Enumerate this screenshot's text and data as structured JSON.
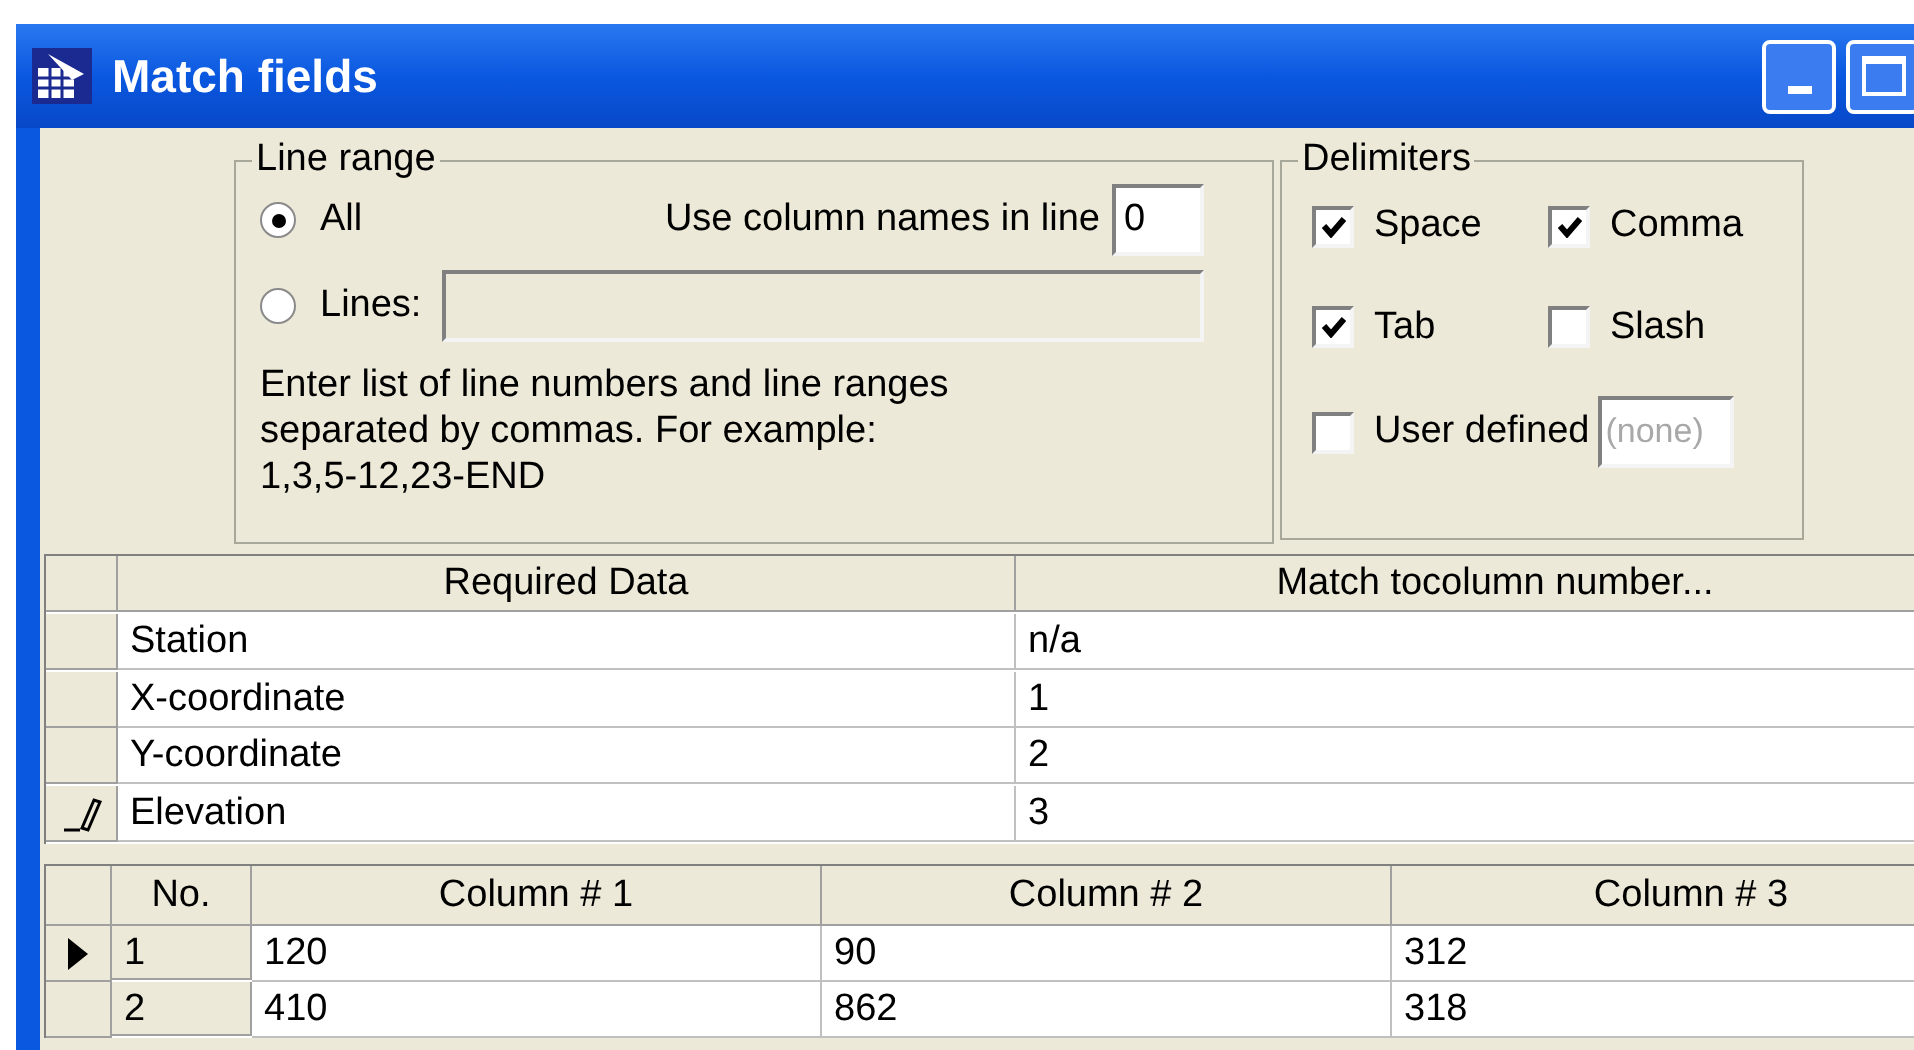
{
  "window": {
    "title": "Match fields"
  },
  "line_range": {
    "title": "Line range",
    "options": [
      {
        "label": "All",
        "selected": true
      },
      {
        "label": "Lines:",
        "selected": false
      }
    ],
    "lines_field": {
      "disabled": true
    },
    "column_names_label": "Use column names in line",
    "column_names_value": "0",
    "help": "Enter list of line numbers and line ranges separated by commas. For example:",
    "example": "1,3,5-12,23-END"
  },
  "delimiters": {
    "title": "Delimiters",
    "options": [
      {
        "label": "Space",
        "checked": true
      },
      {
        "label": "Comma",
        "checked": true
      },
      {
        "label": "Tab",
        "checked": true
      },
      {
        "label": "Slash",
        "checked": false
      },
      {
        "label": "User defined",
        "checked": false
      }
    ],
    "user_defined_placeholder": "(none)"
  },
  "match_table": {
    "columns": [
      "Required Data",
      "Match tocolumn number..."
    ],
    "rows": [
      {
        "cells": [
          "Station",
          "n/a"
        ],
        "editing": false
      },
      {
        "cells": [
          "X-coordinate",
          "1"
        ],
        "editing": false
      },
      {
        "cells": [
          "Y-coordinate",
          "2"
        ],
        "editing": false
      },
      {
        "cells": [
          "Elevation",
          "3"
        ],
        "editing": true
      }
    ]
  },
  "preview_table": {
    "columns": [
      "No.",
      "Column # 1",
      "Column # 2",
      "Column # 3"
    ],
    "rows": [
      {
        "cells": [
          "1",
          "120",
          "90",
          "312"
        ],
        "selected": true
      },
      {
        "cells": [
          "2",
          "410",
          "862",
          "318"
        ],
        "selected": false
      }
    ]
  }
}
